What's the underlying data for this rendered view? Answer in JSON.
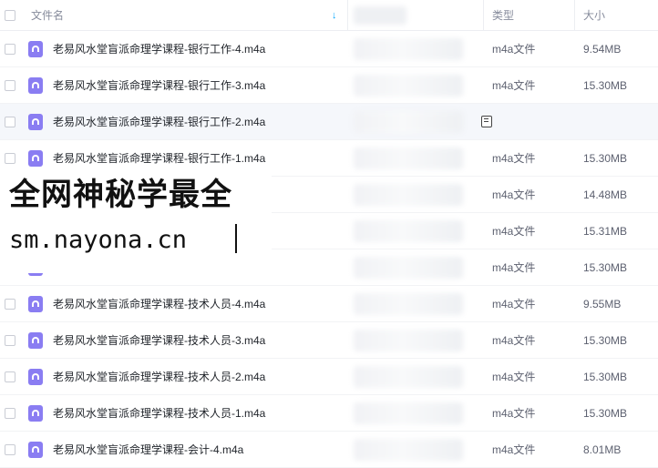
{
  "header": {
    "name_label": "文件名",
    "type_label": "类型",
    "size_label": "大小",
    "sort_icon": "sort-down-arrow-icon"
  },
  "files": [
    {
      "name": "老易风水堂盲派命理学课程-银行工作-4.m4a",
      "type": "m4a文件",
      "size": "9.54MB"
    },
    {
      "name": "老易风水堂盲派命理学课程-银行工作-3.m4a",
      "type": "m4a文件",
      "size": "15.30MB"
    },
    {
      "name": "老易风水堂盲派命理学课程-银行工作-2.m4a",
      "type": "",
      "size": ""
    },
    {
      "name": "老易风水堂盲派命理学课程-银行工作-1.m4a",
      "type": "m4a文件",
      "size": "15.30MB"
    },
    {
      "name": "",
      "type": "m4a文件",
      "size": "14.48MB"
    },
    {
      "name": "",
      "type": "m4a文件",
      "size": "15.31MB"
    },
    {
      "name": "",
      "type": "m4a文件",
      "size": "15.30MB"
    },
    {
      "name": "老易风水堂盲派命理学课程-技术人员-4.m4a",
      "type": "m4a文件",
      "size": "9.55MB"
    },
    {
      "name": "老易风水堂盲派命理学课程-技术人员-3.m4a",
      "type": "m4a文件",
      "size": "15.30MB"
    },
    {
      "name": "老易风水堂盲派命理学课程-技术人员-2.m4a",
      "type": "m4a文件",
      "size": "15.30MB"
    },
    {
      "name": "老易风水堂盲派命理学课程-技术人员-1.m4a",
      "type": "m4a文件",
      "size": "15.30MB"
    },
    {
      "name": "老易风水堂盲派命理学课程-会计-4.m4a",
      "type": "m4a文件",
      "size": "8.01MB"
    }
  ],
  "hovered_row_index": 2,
  "watermark": {
    "line1": "全网神秘学最全",
    "line2": "sm.nayona.cn"
  },
  "colors": {
    "accent": "#06a7ff",
    "file_icon": "#8a7df2",
    "hover_row": "#f5f7fb"
  },
  "icons": {
    "file": "audio-file-icon",
    "row_action": "document-icon"
  }
}
